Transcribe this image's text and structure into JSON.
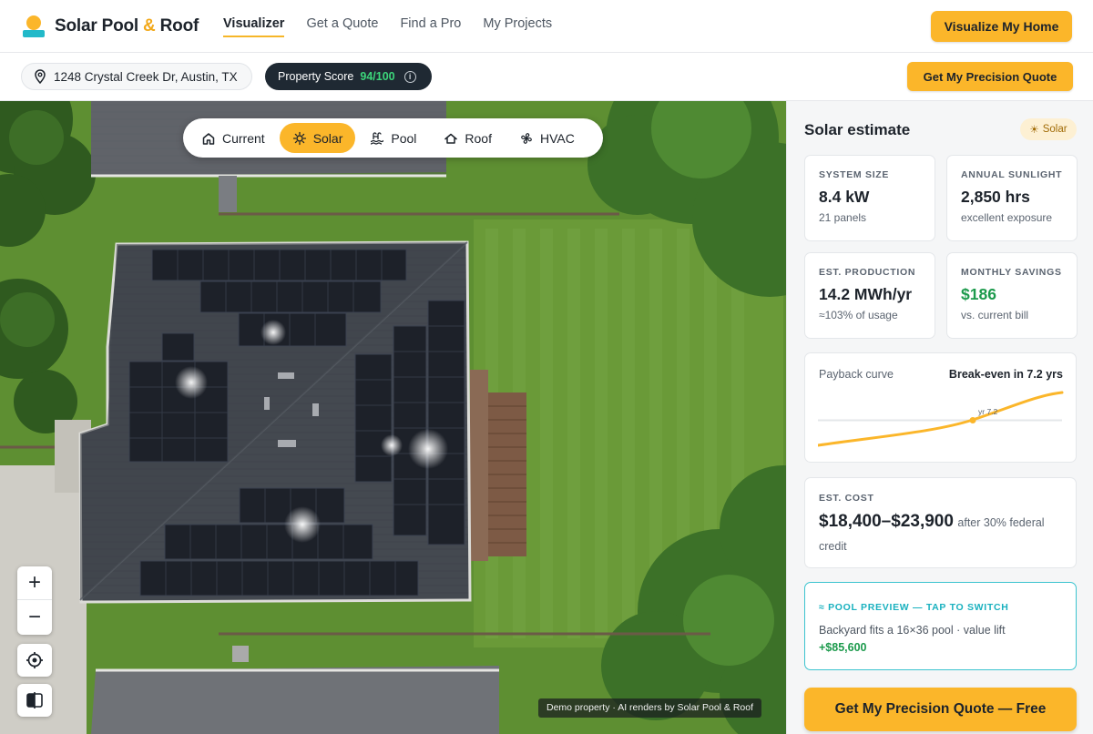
{
  "brand": {
    "name_part1": "Solar Pool ",
    "amp": "&",
    "name_part2": " Roof",
    "logo_icon": "sun-over-water-logo"
  },
  "nav": {
    "links": [
      {
        "label": "Visualizer",
        "active": true
      },
      {
        "label": "Get a Quote",
        "active": false
      },
      {
        "label": "Find a Pro",
        "active": false
      },
      {
        "label": "My Projects",
        "active": false
      }
    ],
    "cta_label": "Visualize My Home"
  },
  "subbar": {
    "address": "1248 Crystal Creek Dr, Austin, TX",
    "score_label": "Property Score",
    "score_value": "94/100",
    "quote_label": "Get My Precision Quote"
  },
  "map": {
    "modes": [
      {
        "label": "Current",
        "icon": "home-icon",
        "active": false
      },
      {
        "label": "Solar",
        "icon": "sun-icon",
        "active": true
      },
      {
        "label": "Pool",
        "icon": "pool-icon",
        "active": false
      },
      {
        "label": "Roof",
        "icon": "roof-icon",
        "active": false
      },
      {
        "label": "HVAC",
        "icon": "fan-icon",
        "active": false
      }
    ],
    "zoom_in": "+",
    "zoom_out": "−",
    "credit": "Demo property · AI renders by Solar Pool & Roof"
  },
  "panel": {
    "title": "Solar estimate",
    "tag": "Solar",
    "stats": [
      {
        "label": "SYSTEM SIZE",
        "value": "8.4 kW",
        "sub": "21 panels",
        "accent": false
      },
      {
        "label": "ANNUAL SUNLIGHT",
        "value": "2,850 hrs",
        "sub": "excellent exposure",
        "accent": false
      },
      {
        "label": "EST. PRODUCTION",
        "value": "14.2 MWh/yr",
        "sub": "≈103% of usage",
        "accent": false
      },
      {
        "label": "MONTHLY SAVINGS",
        "value": "$186",
        "sub": "vs. current bill",
        "accent": true
      }
    ],
    "payback": {
      "label": "Payback curve",
      "breakeven": "Break-even in 7.2 yrs",
      "marker_label": "yr 7.2"
    },
    "cost": {
      "label": "EST. COST",
      "value": "$18,400–$23,900",
      "note": "after 30% federal credit"
    },
    "pool_preview": {
      "heading": "≈ POOL PREVIEW — TAP TO SWITCH",
      "text": "Backyard fits a 16×36 pool · value lift",
      "lift": "+$85,600"
    },
    "cta_label": "Get My Precision Quote — Free"
  },
  "colors": {
    "accent": "#fbb62a",
    "teal": "#22b9c9",
    "positive": "#1c9a4c",
    "dark": "#1f2933"
  }
}
